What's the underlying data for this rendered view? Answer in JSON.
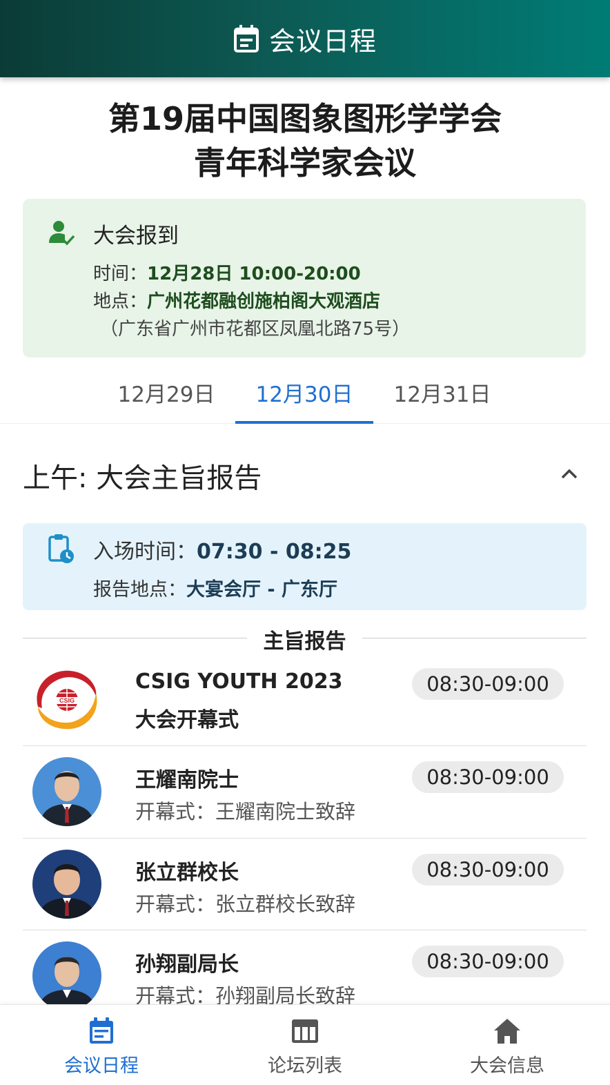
{
  "header": {
    "title": "会议日程"
  },
  "conference": {
    "title_line1": "第19届中国图象图形学学会",
    "title_line2": "青年科学家会议"
  },
  "registration": {
    "title": "大会报到",
    "time_label": "时间：",
    "time_value": "12月28日 10:00-20:00",
    "place_label": "地点：",
    "place_value": "广州花都融创施柏阁大观酒店",
    "address": "（广东省广州市花都区凤凰北路75号）"
  },
  "tabs": [
    {
      "label": "12月29日",
      "active": false
    },
    {
      "label": "12月30日",
      "active": true
    },
    {
      "label": "12月31日",
      "active": false
    }
  ],
  "section": {
    "title": "上午: 大会主旨报告",
    "entry_label": "入场时间：",
    "entry_value": "07:30 - 08:25",
    "venue_label": "报告地点：",
    "venue_value": "大宴会厅 - 广东厅",
    "divider_label": "主旨报告"
  },
  "items": [
    {
      "name": "CSIG YOUTH 2023",
      "desc": "大会开幕式",
      "time": "08:30-09:00",
      "avatar": "csig-logo",
      "logo_text": "CSIG"
    },
    {
      "name": "王耀南院士",
      "desc": "开幕式：王耀南院士致辞",
      "time": "08:30-09:00",
      "avatar": "speaker-photo"
    },
    {
      "name": "张立群校长",
      "desc": "开幕式：张立群校长致辞",
      "time": "08:30-09:00",
      "avatar": "speaker-photo"
    },
    {
      "name": "孙翔副局长",
      "desc": "开幕式：孙翔副局长致辞",
      "time": "08:30-09:00",
      "avatar": "speaker-photo"
    }
  ],
  "bottom_nav": [
    {
      "label": "会议日程",
      "icon": "calendar-icon",
      "active": true
    },
    {
      "label": "论坛列表",
      "icon": "table-icon",
      "active": false
    },
    {
      "label": "大会信息",
      "icon": "home-icon",
      "active": false
    }
  ],
  "colors": {
    "accent": "#1f6fd1",
    "header_start": "#0b3b36",
    "header_end": "#007c75",
    "reg_bg": "#e8f4e8",
    "venue_bg": "#e4f3fb"
  }
}
